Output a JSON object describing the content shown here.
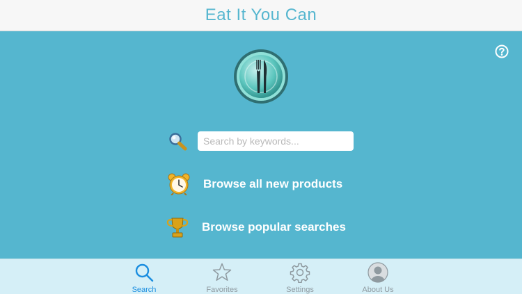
{
  "header": {
    "title": "Eat It You Can"
  },
  "search": {
    "placeholder": "Search by keywords..."
  },
  "actions": {
    "browse_new": "Browse all new products",
    "browse_popular": "Browse popular searches"
  },
  "tabs": [
    {
      "label": "Search",
      "icon": "search-icon",
      "active": true
    },
    {
      "label": "Favorites",
      "icon": "star-icon",
      "active": false
    },
    {
      "label": "Settings",
      "icon": "gear-icon",
      "active": false
    },
    {
      "label": "About Us",
      "icon": "person-icon",
      "active": false
    }
  ],
  "colors": {
    "background": "#55b6cf",
    "header_bg": "#f7f7f7",
    "title": "#56b6cf",
    "tabbar_bg": "#d5eff7",
    "tab_active": "#1b8ee0",
    "tab_inactive": "#8f9aa0"
  }
}
